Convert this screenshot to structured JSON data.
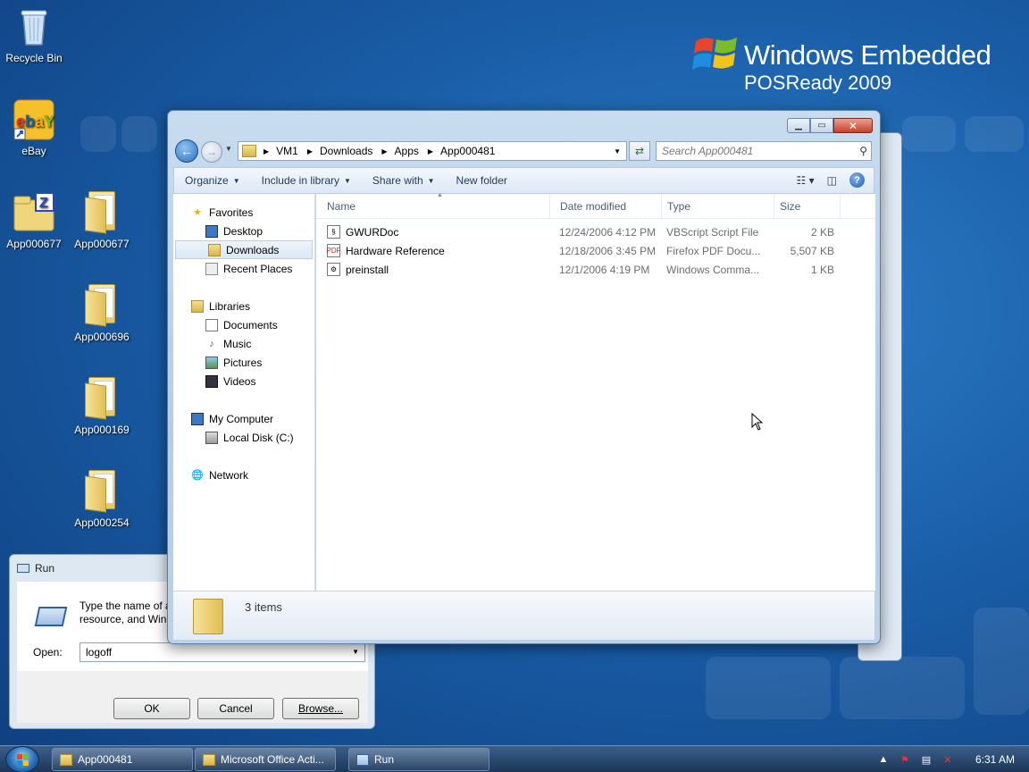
{
  "brand": {
    "line1": "Windows Embedded",
    "line2": "POSReady 2009"
  },
  "desktop_icons": [
    {
      "label": "Recycle Bin"
    },
    {
      "label": "eBay"
    },
    {
      "label": "App000677"
    },
    {
      "label": "App000677"
    },
    {
      "label": "App000696"
    },
    {
      "label": "App000169"
    },
    {
      "label": "App000254"
    }
  ],
  "explorer": {
    "breadcrumb": [
      "VM1",
      "Downloads",
      "Apps",
      "App000481"
    ],
    "search_placeholder": "Search App000481",
    "toolbar": {
      "organize": "Organize",
      "include": "Include in library",
      "share": "Share with",
      "new_folder": "New folder"
    },
    "nav": {
      "favorites": "Favorites",
      "desktop": "Desktop",
      "downloads": "Downloads",
      "recent": "Recent Places",
      "libraries": "Libraries",
      "documents": "Documents",
      "music": "Music",
      "pictures": "Pictures",
      "videos": "Videos",
      "my_computer": "My Computer",
      "local_disk": "Local Disk (C:)",
      "network": "Network"
    },
    "columns": {
      "name": "Name",
      "date": "Date modified",
      "type": "Type",
      "size": "Size"
    },
    "files": [
      {
        "name": "GWURDoc",
        "date": "12/24/2006 4:12 PM",
        "type": "VBScript Script File",
        "size": "2 KB"
      },
      {
        "name": "Hardware Reference",
        "date": "12/18/2006 3:45 PM",
        "type": "Firefox PDF Docu...",
        "size": "5,507 KB"
      },
      {
        "name": "preinstall",
        "date": "12/1/2006 4:19 PM",
        "type": "Windows Comma...",
        "size": "1 KB"
      }
    ],
    "status": "3 items"
  },
  "run_dialog": {
    "title": "Run",
    "desc_line1": "Type the name of a p",
    "desc_line2": "resource, and Windo",
    "open_label": "Open:",
    "open_value": "logoff",
    "ok": "OK",
    "cancel": "Cancel",
    "browse": "Browse..."
  },
  "taskbar": {
    "tasks": [
      "App000481",
      "Microsoft Office Acti...",
      "Run"
    ],
    "clock": "6:31 AM"
  }
}
